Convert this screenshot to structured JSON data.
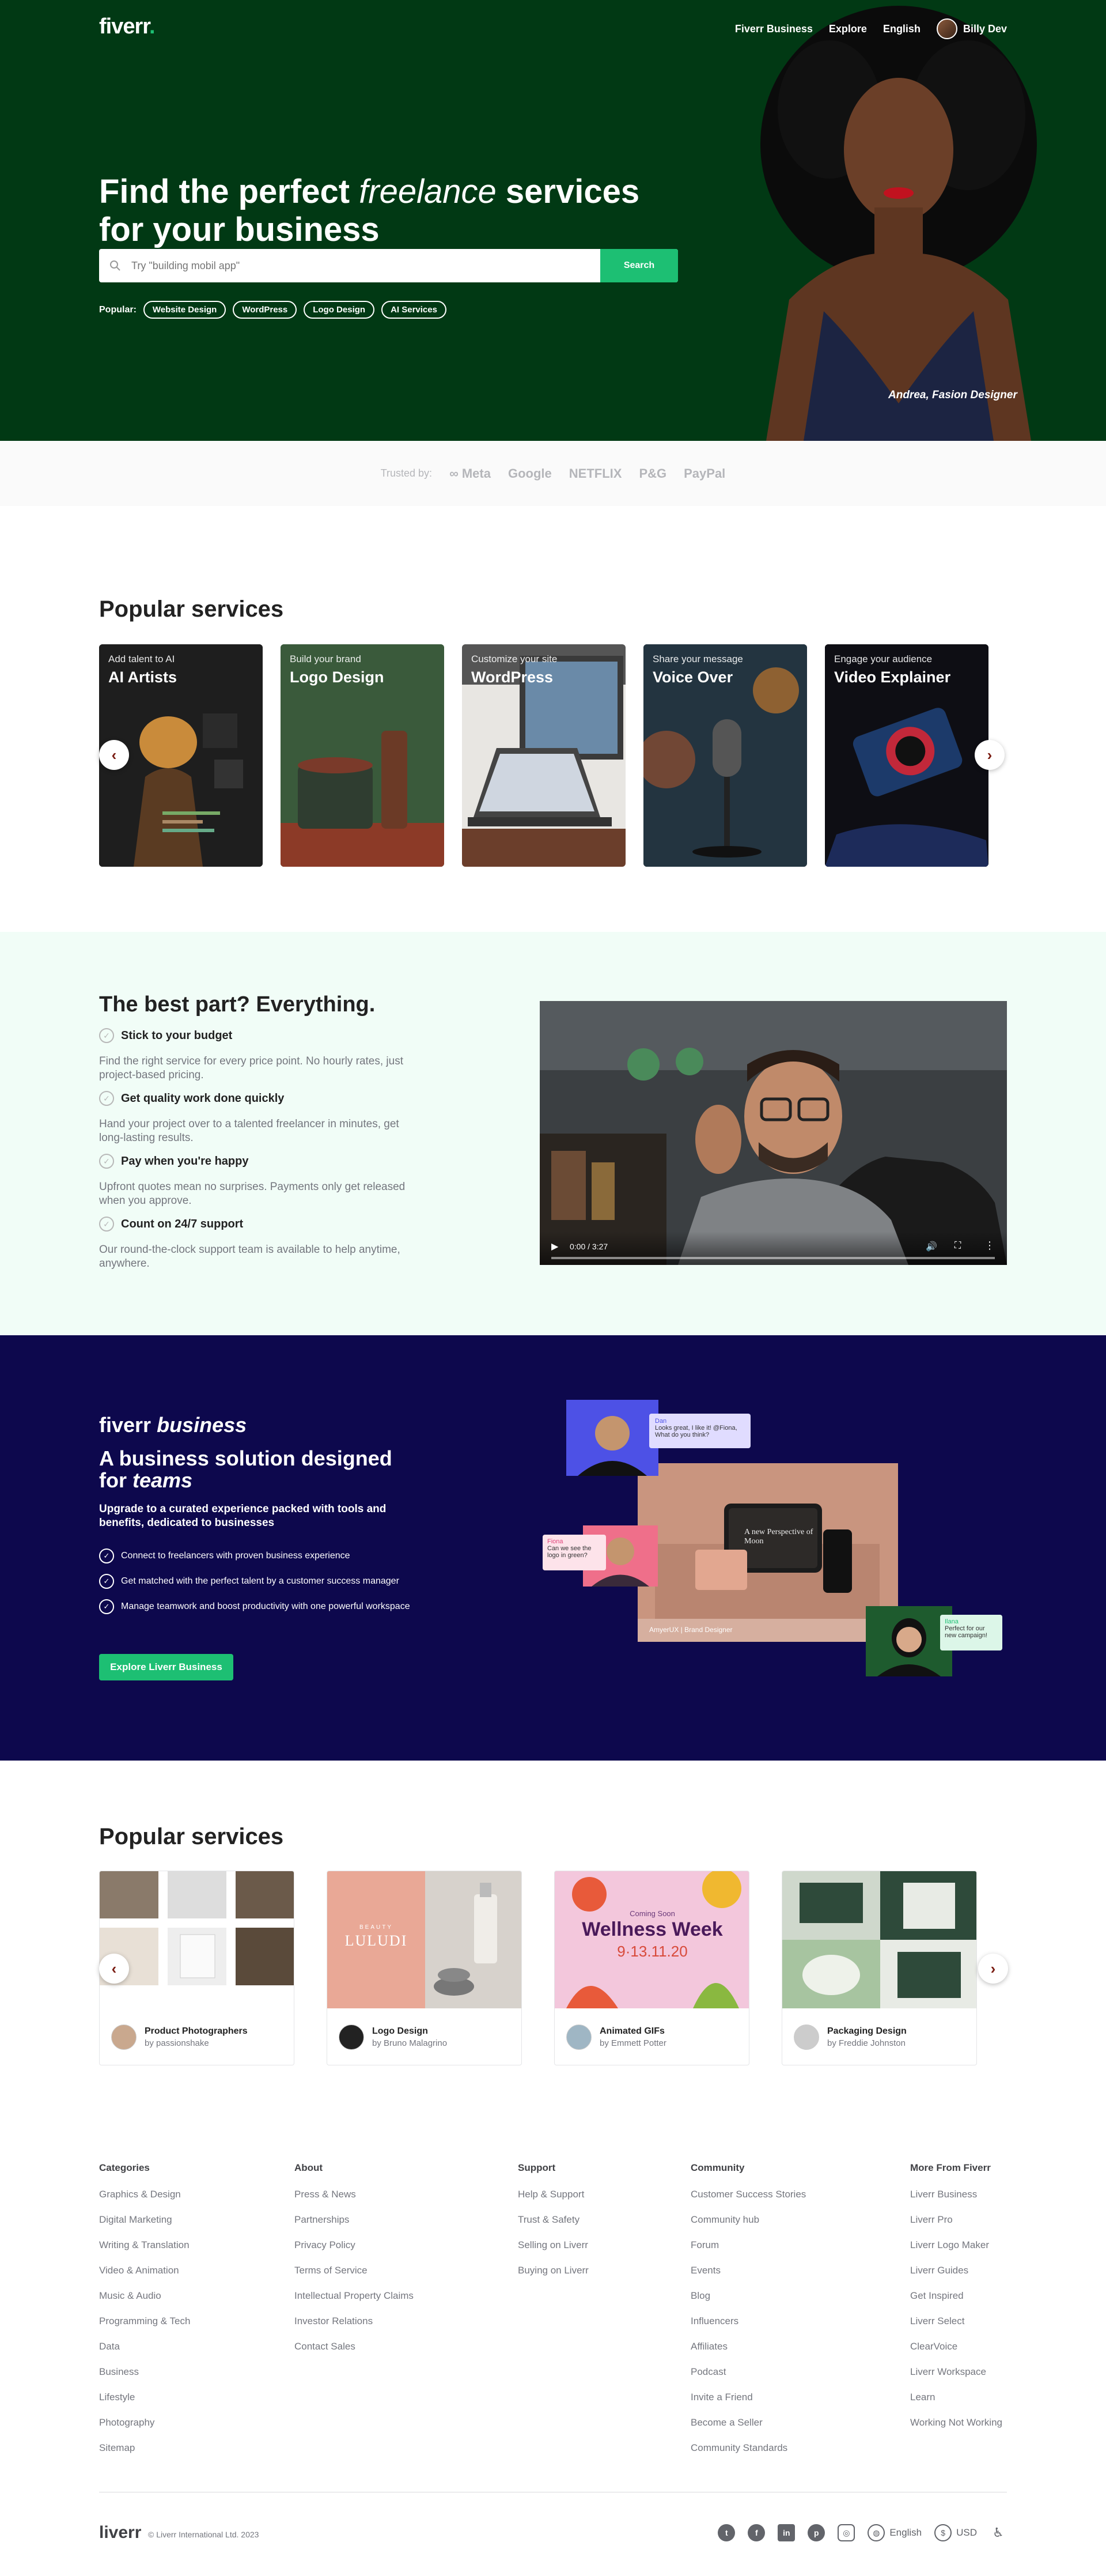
{
  "header": {
    "logo": "fiverr",
    "logo_dot": ".",
    "nav": [
      "Fiverr Business",
      "Explore",
      "English"
    ],
    "user_name": "Billy Dev"
  },
  "hero": {
    "title_part1": "Find the perfect ",
    "title_italic": "freelance",
    "title_part2": " services for your business",
    "search_placeholder": "Try \"building mobil app\"",
    "search_button": "Search",
    "popular_label": "Popular:",
    "popular_tags": [
      "Website Design",
      "WordPress",
      "Logo Design",
      "AI Services"
    ],
    "caption": "Andrea, Fasion Designer"
  },
  "trusted": {
    "label": "Trusted by:",
    "brands": [
      "∞ Meta",
      "Google",
      "NETFLIX",
      "P&G",
      "PayPal"
    ]
  },
  "popular1": {
    "title": "Popular services",
    "cards": [
      {
        "sub": "Add talent to AI",
        "title": "AI Artists"
      },
      {
        "sub": "Build your brand",
        "title": "Logo Design"
      },
      {
        "sub": "Customize your site",
        "title": "WordPress"
      },
      {
        "sub": "Share your message",
        "title": "Voice Over"
      },
      {
        "sub": "Engage your audience",
        "title": "Video Explainer"
      }
    ]
  },
  "best": {
    "title": "The best part? Everything.",
    "items": [
      {
        "title": "Stick to your budget",
        "text": "Find the right service for every price point. No hourly rates, just project-based pricing."
      },
      {
        "title": "Get quality work done quickly",
        "text": "Hand your project over to a talented freelancer in minutes, get long-lasting results."
      },
      {
        "title": "Pay when you're happy",
        "text": "Upfront quotes mean no surprises. Payments only get released when you approve."
      },
      {
        "title": "Count on 24/7 support",
        "text": "Our round-the-clock support team is available to help anytime, anywhere."
      }
    ],
    "video_time": "0:00 / 3:27"
  },
  "business": {
    "logo_word": "fiverr",
    "logo_italic": "business",
    "heading1": "A business solution designed for ",
    "heading_italic": "teams",
    "subtitle": "Upgrade to a curated experience packed with tools and benefits, dedicated to businesses",
    "points": [
      "Connect to freelancers with proven business experience",
      "Get matched with the perfect talent by a customer success manager",
      "Manage teamwork and boost productivity with one powerful workspace"
    ],
    "button": "Explore Liverr Business",
    "chat1_name": "Dan",
    "chat1_text": "Looks great, I like it! @Fiona, What do you think?",
    "chat2_name": "Fiona",
    "chat2_text": "Can we see the logo in green?",
    "chat3_name": "Ilana",
    "chat3_text": "Perfect for our new campaign!",
    "mock_title": "A new Perspective of Moon",
    "mock_footer": "AmyerUX | Brand Designer"
  },
  "popular2": {
    "title": "Popular services",
    "cards": [
      {
        "title": "Product Photographers",
        "author": "by passionshake"
      },
      {
        "title": "Logo Design",
        "author": "by Bruno Malagrino"
      },
      {
        "title": "Animated GIFs",
        "author": "by Emmett Potter"
      },
      {
        "title": "Packaging Design",
        "author": "by Freddie Johnston"
      }
    ],
    "gif_coming": "Coming Soon",
    "gif_title": "Wellness Week",
    "gif_date": "9·13.11.20",
    "logo_brand": "LULUDI",
    "logo_brand_small": "BEAUTY"
  },
  "footer": {
    "columns": [
      {
        "title": "Categories",
        "links": [
          "Graphics & Design",
          "Digital Marketing",
          "Writing & Translation",
          "Video & Animation",
          "Music & Audio",
          "Programming & Tech",
          "Data",
          "Business",
          "Lifestyle",
          "Photography",
          "Sitemap"
        ]
      },
      {
        "title": "About",
        "links": [
          "Press & News",
          "Partnerships",
          "Privacy Policy",
          "Terms of Service",
          "Intellectual Property Claims",
          "Investor Relations",
          "Contact Sales"
        ]
      },
      {
        "title": "Support",
        "links": [
          "Help & Support",
          "Trust & Safety",
          "Selling on Liverr",
          "Buying on Liverr"
        ]
      },
      {
        "title": "Community",
        "links": [
          "Customer Success Stories",
          "Community hub",
          "Forum",
          "Events",
          "Blog",
          "Influencers",
          "Affiliates",
          "Podcast",
          "Invite a Friend",
          "Become a Seller",
          "Community Standards"
        ]
      },
      {
        "title": "More From Fiverr",
        "links": [
          "Liverr Business",
          "Liverr Pro",
          "Liverr Logo Maker",
          "Liverr Guides",
          "Get Inspired",
          "Liverr Select",
          "ClearVoice",
          "Liverr Workspace",
          "Learn",
          "Working Not Working"
        ]
      }
    ],
    "bottom_logo": "liverr",
    "copyright": "© Liverr International Ltd. 2023",
    "language": "English",
    "currency": "USD"
  }
}
